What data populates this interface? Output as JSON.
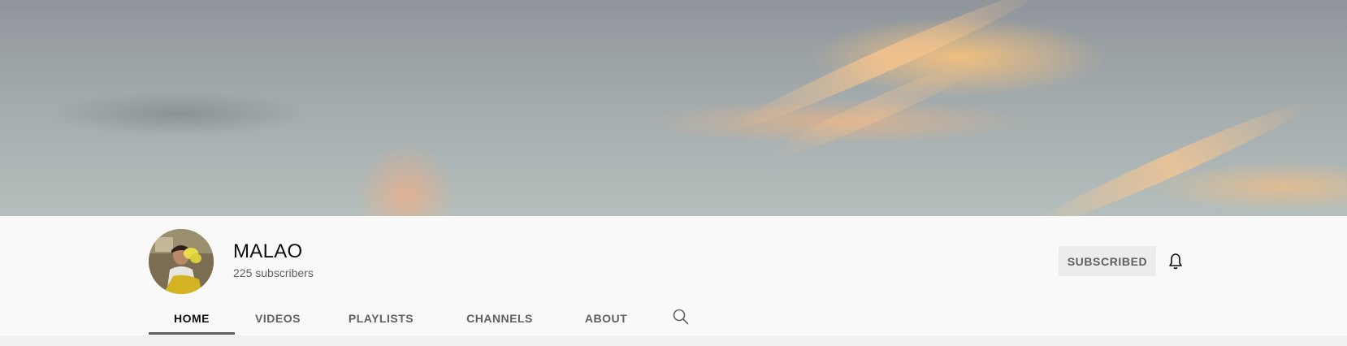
{
  "channel": {
    "name": "MALAO",
    "subscribers": "225 subscribers"
  },
  "actions": {
    "subscribe_label": "SUBSCRIBED"
  },
  "tabs": [
    {
      "label": "HOME",
      "active": true
    },
    {
      "label": "VIDEOS",
      "active": false
    },
    {
      "label": "PLAYLISTS",
      "active": false
    },
    {
      "label": "CHANNELS",
      "active": false
    },
    {
      "label": "ABOUT",
      "active": false
    }
  ],
  "icons": {
    "notification": "bell-icon",
    "search": "search-icon"
  },
  "colors": {
    "header_bg": "#f9f9f9",
    "active_tab": "#0f0f0f",
    "inactive_tab": "#606060",
    "button_bg": "#ececec"
  }
}
